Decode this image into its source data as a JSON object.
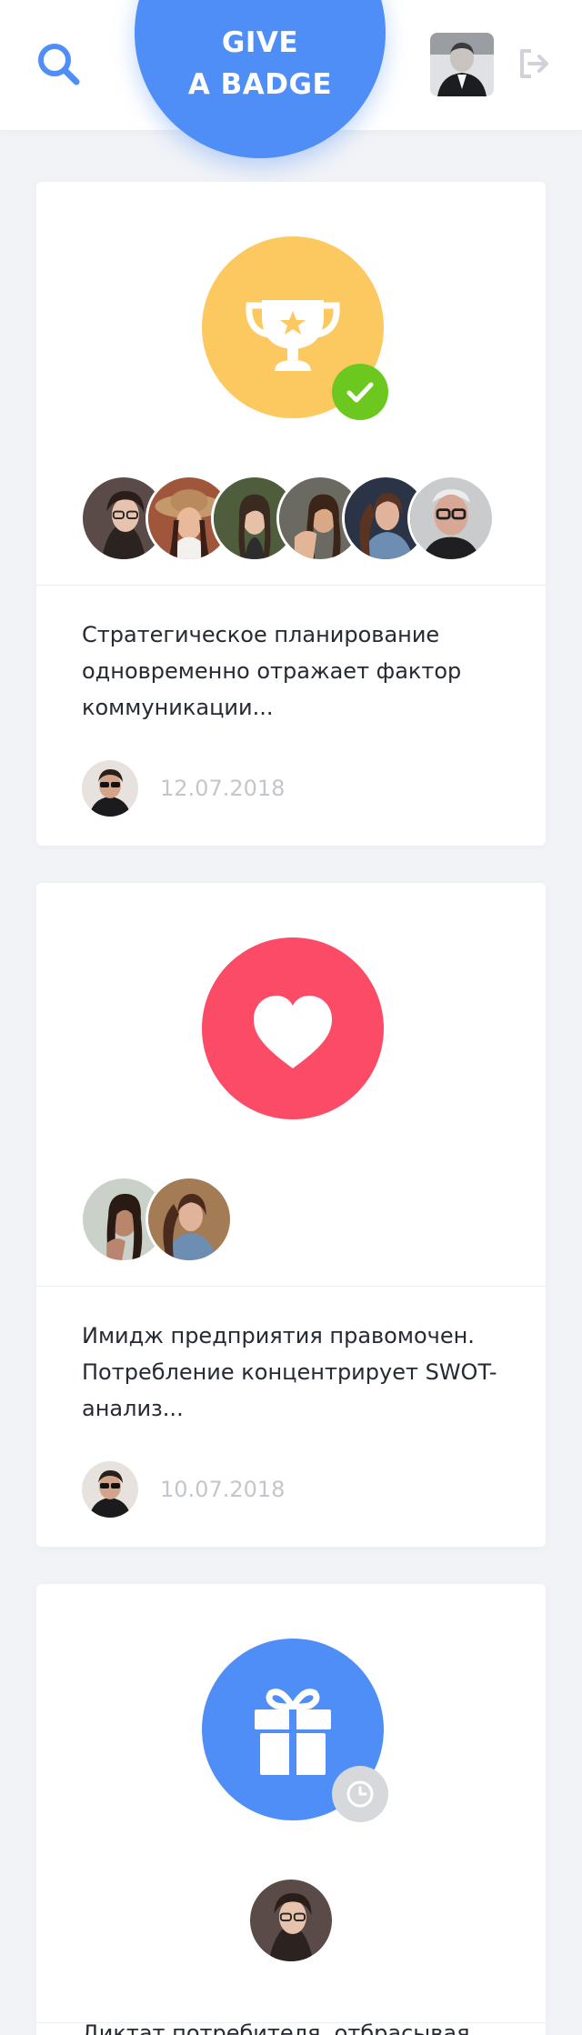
{
  "header": {
    "give_badge_line1": "GIVE",
    "give_badge_line2": "A BADGE",
    "icons": {
      "search": "search-icon",
      "logout": "logout-icon",
      "user": "user-avatar"
    },
    "colors": {
      "accent": "#4f8ef7",
      "icon_gray": "#cfd2d8"
    }
  },
  "feed": [
    {
      "badge": "trophy-icon",
      "badge_color": "#fcc860",
      "status": "check-icon",
      "status_color": "#6cc81e",
      "recipients_count": 6,
      "text": "Стратегическое планирование одновременно отражает фактор коммуникации...",
      "date": "12.07.2018"
    },
    {
      "badge": "heart-icon",
      "badge_color": "#fc4b66",
      "recipients_count": 2,
      "text": "Имидж предприятия правомочен. Потребление концентрирует SWOT-анализ...",
      "date": "10.07.2018"
    },
    {
      "badge": "gift-icon",
      "badge_color": "#4f8ef7",
      "status": "clock-icon",
      "status_color": "#d6d8dc",
      "recipients_count": 1,
      "text": "Диктат потребителя, отбрасывая"
    }
  ]
}
